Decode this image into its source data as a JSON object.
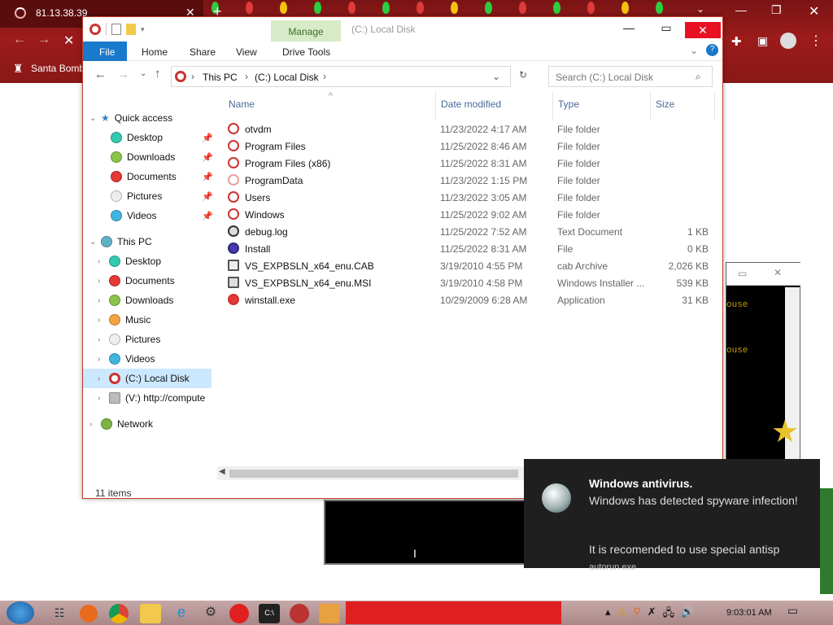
{
  "browser": {
    "tab_title": "81.13.38.39",
    "bookmark": "Santa Bomb",
    "colors": {
      "bg": "#8f1a1a"
    }
  },
  "explorer": {
    "manage_tab": "Manage",
    "window_title": "(C:) Local Disk",
    "ribbon_tabs": [
      "File",
      "Home",
      "Share",
      "View",
      "Drive Tools"
    ],
    "breadcrumb": [
      "This PC",
      "(C:) Local Disk"
    ],
    "search_placeholder": "Search (C:) Local Disk",
    "nav": {
      "quick_access": "Quick access",
      "quick_items": [
        "Desktop",
        "Downloads",
        "Documents",
        "Pictures",
        "Videos"
      ],
      "this_pc": "This PC",
      "pc_items": [
        "Desktop",
        "Documents",
        "Downloads",
        "Music",
        "Pictures",
        "Videos",
        "(C:) Local Disk",
        "(V:) http://compute"
      ],
      "network": "Network"
    },
    "columns": {
      "name": "Name",
      "date": "Date modified",
      "type": "Type",
      "size": "Size"
    },
    "files": [
      {
        "name": "otvdm",
        "date": "11/23/2022 4:17 AM",
        "type": "File folder",
        "size": ""
      },
      {
        "name": "Program Files",
        "date": "11/25/2022 8:46 AM",
        "type": "File folder",
        "size": ""
      },
      {
        "name": "Program Files (x86)",
        "date": "11/25/2022 8:31 AM",
        "type": "File folder",
        "size": ""
      },
      {
        "name": "ProgramData",
        "date": "11/23/2022 1:15 PM",
        "type": "File folder",
        "size": ""
      },
      {
        "name": "Users",
        "date": "11/23/2022 3:05 AM",
        "type": "File folder",
        "size": ""
      },
      {
        "name": "Windows",
        "date": "11/25/2022 9:02 AM",
        "type": "File folder",
        "size": ""
      },
      {
        "name": "debug.log",
        "date": "11/25/2022 7:52 AM",
        "type": "Text Document",
        "size": "1 KB"
      },
      {
        "name": "Install",
        "date": "11/25/2022 8:31 AM",
        "type": "File",
        "size": "0 KB"
      },
      {
        "name": "VS_EXPBSLN_x64_enu.CAB",
        "date": "3/19/2010 4:55 PM",
        "type": "cab Archive",
        "size": "2,026 KB"
      },
      {
        "name": "VS_EXPBSLN_x64_enu.MSI",
        "date": "3/19/2010 4:58 PM",
        "type": "Windows Installer ...",
        "size": "539 KB"
      },
      {
        "name": "winstall.exe",
        "date": "10/29/2009 6:28 AM",
        "type": "Application",
        "size": "31 KB"
      }
    ],
    "status": "11 items"
  },
  "console": {
    "line1": "ouse",
    "line2": "ouse"
  },
  "notification": {
    "title": "Windows antivirus.",
    "line1": "Windows has detected spyware infection!",
    "line2": "It is recomended to use special antisp",
    "app": "autorun.exe"
  },
  "taskbar": {
    "clock": "9:03:01 AM"
  }
}
